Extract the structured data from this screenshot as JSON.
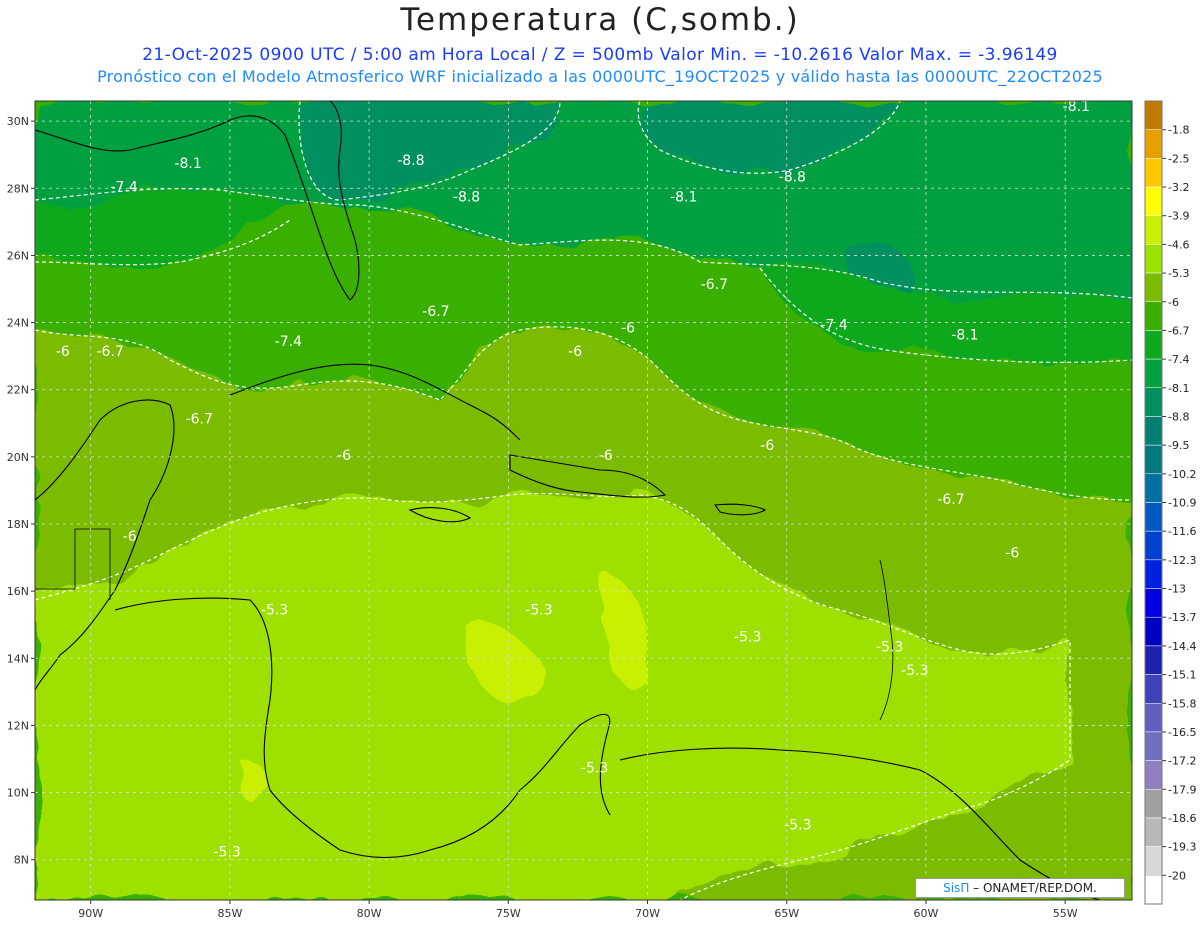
{
  "header": {
    "title": "Temperatura (C,somb.)",
    "subtitle1": "21-Oct-2025  0900 UTC / 5:00 am Hora Local / Z = 500mb  Valor Min. = -10.2616  Valor Max. = -3.96149",
    "subtitle2": "Pronóstico con el Modelo Atmosferico WRF inicializado a las 0000UTC_19OCT2025 y válido hasta las  0000UTC_22OCT2025"
  },
  "map": {
    "lon_range": [
      -92,
      -52.6
    ],
    "lat_range": [
      6.8,
      30.6
    ],
    "lat_ticks": [
      {
        "value": 30,
        "label": "30N"
      },
      {
        "value": 28,
        "label": "28N"
      },
      {
        "value": 26,
        "label": "26N"
      },
      {
        "value": 24,
        "label": "24N"
      },
      {
        "value": 22,
        "label": "22N"
      },
      {
        "value": 20,
        "label": "20N"
      },
      {
        "value": 18,
        "label": "18N"
      },
      {
        "value": 16,
        "label": "16N"
      },
      {
        "value": 14,
        "label": "14N"
      },
      {
        "value": 12,
        "label": "12N"
      },
      {
        "value": 10,
        "label": "10N"
      },
      {
        "value": 8,
        "label": "8N"
      }
    ],
    "lon_ticks": [
      {
        "value": -90,
        "label": "90W"
      },
      {
        "value": -85,
        "label": "85W"
      },
      {
        "value": -80,
        "label": "80W"
      },
      {
        "value": -75,
        "label": "75W"
      },
      {
        "value": -70,
        "label": "70W"
      },
      {
        "value": -65,
        "label": "65W"
      },
      {
        "value": -60,
        "label": "60W"
      },
      {
        "value": -55,
        "label": "55W"
      }
    ],
    "contour_labels": [
      {
        "text": "-8.1",
        "lon": -86.5,
        "lat": 28.6
      },
      {
        "text": "-7.4",
        "lon": -88.8,
        "lat": 27.9
      },
      {
        "text": "-8.8",
        "lon": -78.5,
        "lat": 28.7
      },
      {
        "text": "-8.8",
        "lon": -76.5,
        "lat": 27.6
      },
      {
        "text": "-8.8",
        "lon": -64.8,
        "lat": 28.2
      },
      {
        "text": "-8.1",
        "lon": -68.7,
        "lat": 27.6
      },
      {
        "text": "-8.1",
        "lon": -54.6,
        "lat": 30.3
      },
      {
        "text": "-6.7",
        "lon": -77.6,
        "lat": 24.2
      },
      {
        "text": "-6.7",
        "lon": -67.6,
        "lat": 25.0
      },
      {
        "text": "-7.4",
        "lon": -63.3,
        "lat": 23.8
      },
      {
        "text": "-8.1",
        "lon": -58.6,
        "lat": 23.5
      },
      {
        "text": "-6",
        "lon": -91.0,
        "lat": 23.0
      },
      {
        "text": "-6.7",
        "lon": -89.3,
        "lat": 23.0
      },
      {
        "text": "-7.4",
        "lon": -82.9,
        "lat": 23.3
      },
      {
        "text": "-6",
        "lon": -72.6,
        "lat": 23.0
      },
      {
        "text": "-6",
        "lon": -70.7,
        "lat": 23.7
      },
      {
        "text": "-6.7",
        "lon": -86.1,
        "lat": 21.0
      },
      {
        "text": "-6",
        "lon": -80.9,
        "lat": 19.9
      },
      {
        "text": "-6",
        "lon": -71.5,
        "lat": 19.9
      },
      {
        "text": "-6",
        "lon": -65.7,
        "lat": 20.2
      },
      {
        "text": "-6.7",
        "lon": -59.1,
        "lat": 18.6
      },
      {
        "text": "-6",
        "lon": -88.6,
        "lat": 17.5
      },
      {
        "text": "-6",
        "lon": -56.9,
        "lat": 17.0
      },
      {
        "text": "-5.3",
        "lon": -83.4,
        "lat": 15.3
      },
      {
        "text": "-5.3",
        "lon": -73.9,
        "lat": 15.3
      },
      {
        "text": "-5.3",
        "lon": -66.4,
        "lat": 14.5
      },
      {
        "text": "-5.3",
        "lon": -61.3,
        "lat": 14.2
      },
      {
        "text": "-5.3",
        "lon": -60.4,
        "lat": 13.5
      },
      {
        "text": "-5.3",
        "lon": -71.9,
        "lat": 10.6
      },
      {
        "text": "-5.3",
        "lon": -64.6,
        "lat": 8.9
      },
      {
        "text": "-5.3",
        "lon": -85.1,
        "lat": 8.1
      }
    ]
  },
  "colorbar": {
    "levels": [
      {
        "label": "-1.8",
        "color": "#c07a00"
      },
      {
        "label": "-2.5",
        "color": "#e8a000"
      },
      {
        "label": "-3.2",
        "color": "#ffc800"
      },
      {
        "label": "-3.9",
        "color": "#ffff00"
      },
      {
        "label": "-4.6",
        "color": "#c8f000"
      },
      {
        "label": "-5.3",
        "color": "#9ee000"
      },
      {
        "label": "-6",
        "color": "#7cbc00"
      },
      {
        "label": "-6.7",
        "color": "#39b000"
      },
      {
        "label": "-7.4",
        "color": "#0fa81e"
      },
      {
        "label": "-8.1",
        "color": "#05a040"
      },
      {
        "label": "-8.8",
        "color": "#009060"
      },
      {
        "label": "-9.5",
        "color": "#008070"
      },
      {
        "label": "-10.2",
        "color": "#007a80"
      },
      {
        "label": "-10.9",
        "color": "#0070a0"
      },
      {
        "label": "-11.6",
        "color": "#0058c0"
      },
      {
        "label": "-12.3",
        "color": "#0040d0"
      },
      {
        "label": "-13",
        "color": "#0020e0"
      },
      {
        "label": "-13.7",
        "color": "#0000e0"
      },
      {
        "label": "-14.4",
        "color": "#0000c0"
      },
      {
        "label": "-15.1",
        "color": "#2020b0"
      },
      {
        "label": "-15.8",
        "color": "#4040b8"
      },
      {
        "label": "-16.5",
        "color": "#6060c0"
      },
      {
        "label": "-17.2",
        "color": "#7070c0"
      },
      {
        "label": "-17.9",
        "color": "#9080c0"
      },
      {
        "label": "-18.6",
        "color": "#a0a0a0"
      },
      {
        "label": "-19.3",
        "color": "#b8b8b8"
      },
      {
        "label": "-20",
        "color": "#d8d8d8"
      }
    ],
    "bottom_color": "#ffffff"
  },
  "credit": {
    "brand": "SisΠ",
    "text": " – ONAMET/REP.DOM."
  }
}
